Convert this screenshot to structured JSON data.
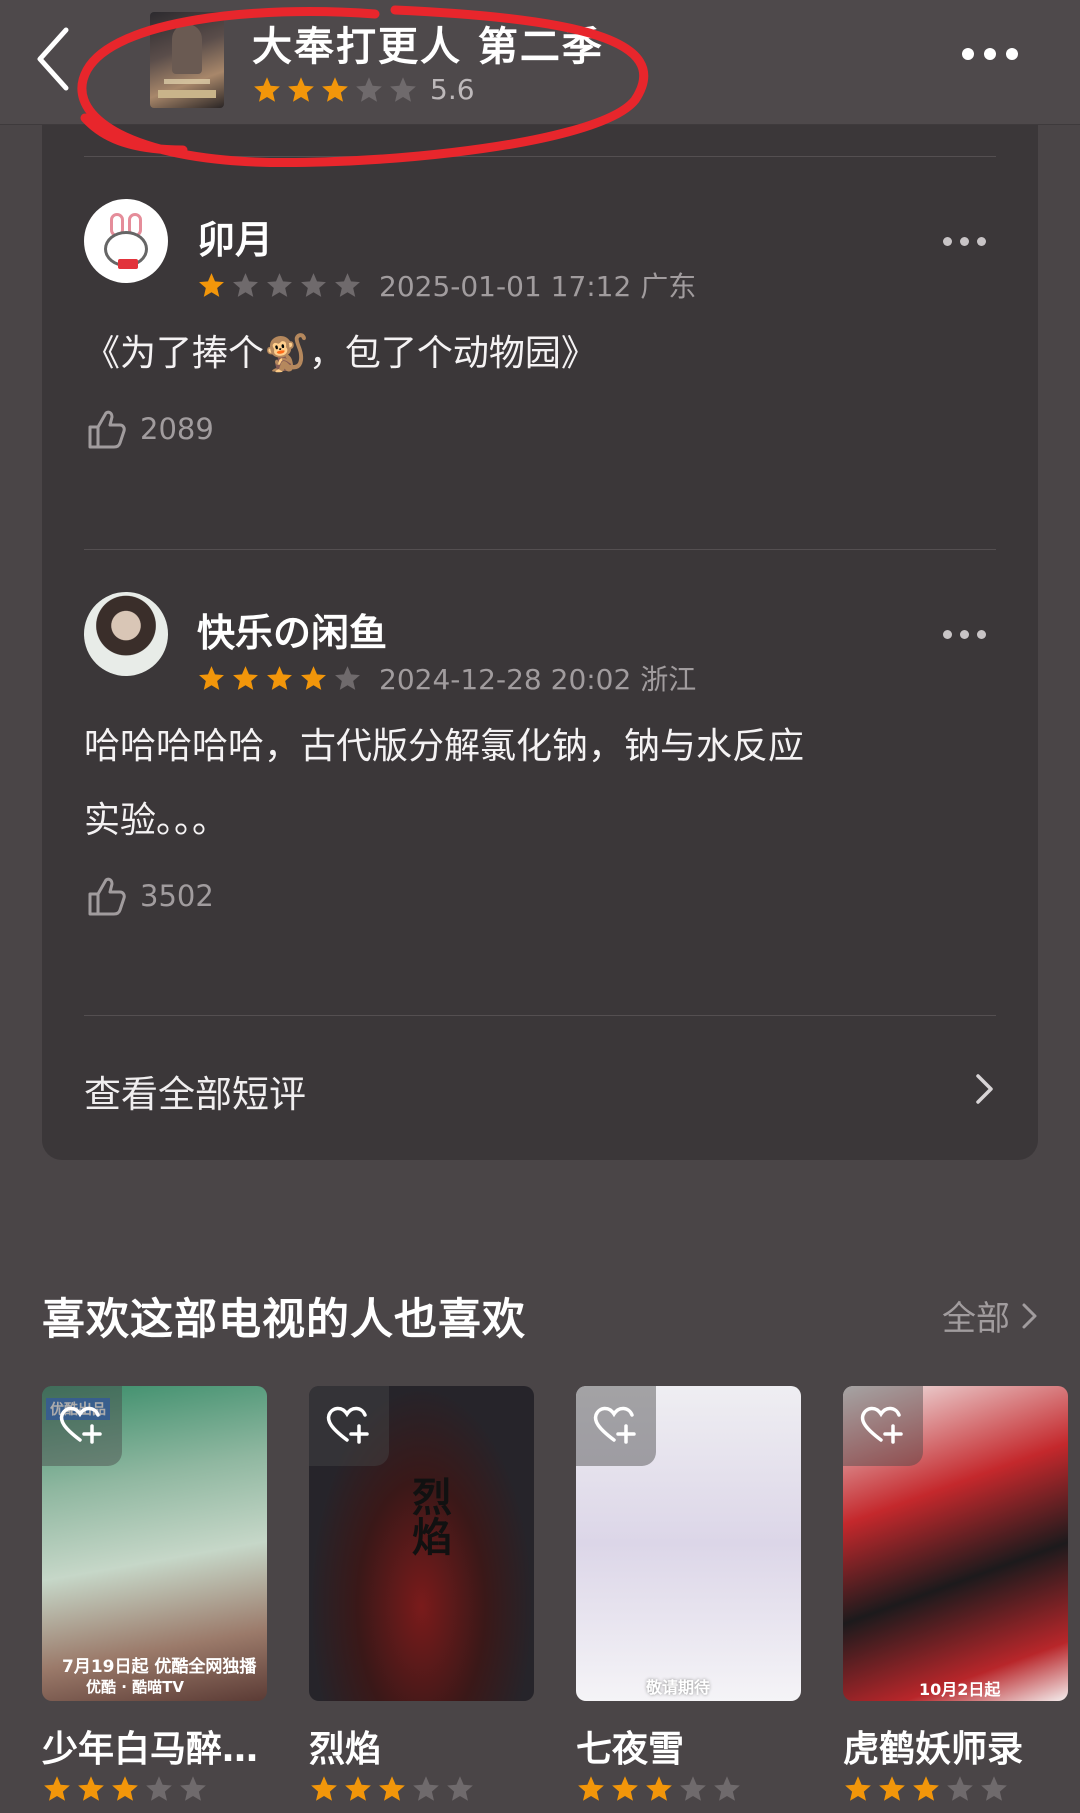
{
  "header": {
    "title": "大奉打更人 第二季",
    "rating_score": "5.6",
    "rating_stars": 3
  },
  "reviews": [
    {
      "username": "卯月",
      "stars": 1,
      "time_location": "2025-01-01 17:12 广东",
      "text_lines": [
        "《为了捧个🐒，包了个动物园》"
      ],
      "likes": "2089"
    },
    {
      "username": "快乐の闲鱼",
      "stars": 4,
      "time_location": "2024-12-28 20:02 浙江",
      "text_lines": [
        "哈哈哈哈哈，古代版分解氯化钠，钠与水反应",
        "实验。。。"
      ],
      "likes": "3502"
    }
  ],
  "see_all_reviews": "查看全部短评",
  "recommendations": {
    "title": "喜欢这部电视的人也喜欢",
    "all_label": "全部",
    "items": [
      {
        "name": "少年白马醉…",
        "stars": 3,
        "poster_text": "7月19日起 优酷全网独播",
        "poster_sub": "优酷 · 酷喵TV",
        "poster_badge": "优酷出品"
      },
      {
        "name": "烈焰",
        "stars": 3,
        "poster_text": "烈焰"
      },
      {
        "name": "七夜雪",
        "stars": 3,
        "poster_text": "敬请期待"
      },
      {
        "name": "虎鹤妖师录",
        "stars": 3,
        "poster_text": "10月2日起"
      }
    ]
  },
  "colors": {
    "star_on": "#f2960a",
    "star_off": "#6f6a6c",
    "annotation": "#e8262c",
    "background": "#4a4547",
    "card": "#3b3739"
  }
}
